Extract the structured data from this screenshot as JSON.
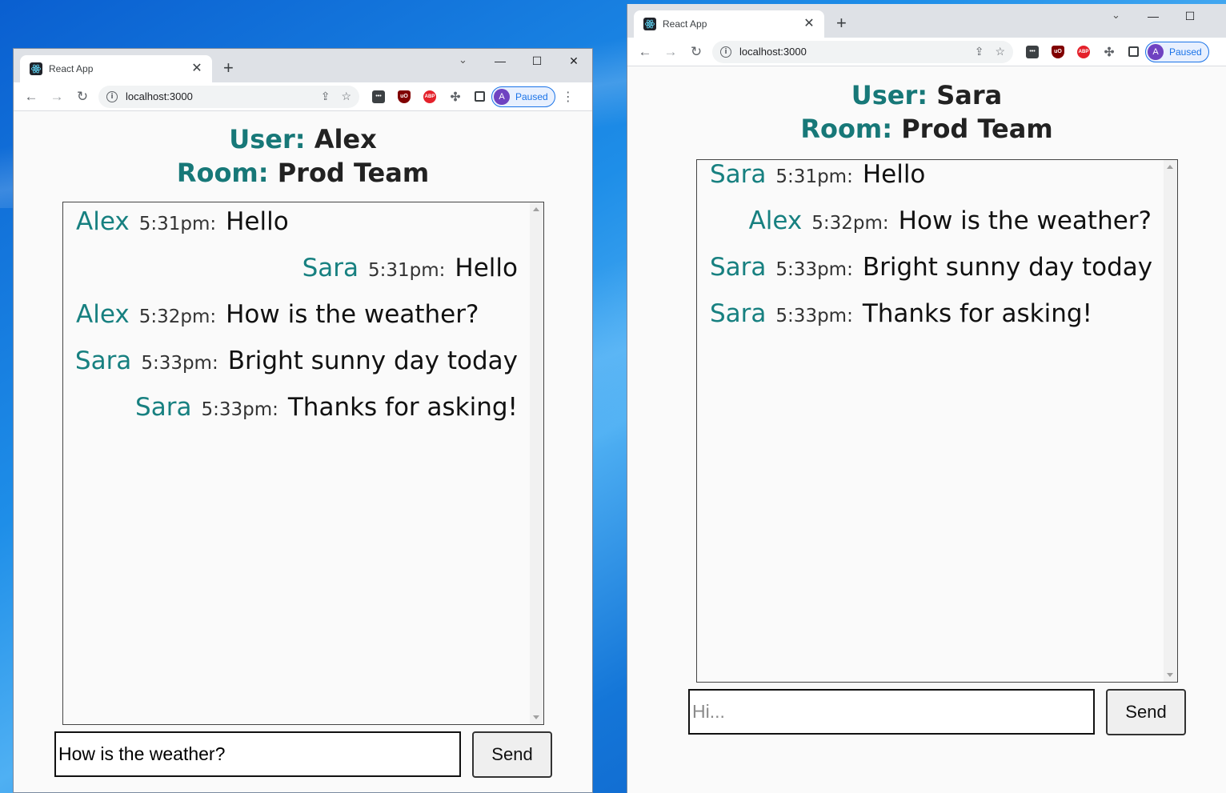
{
  "left_window": {
    "tab": {
      "favicon": "react-icon",
      "title": "React App",
      "close": "✕"
    },
    "new_tab": "+",
    "window_controls": {
      "tab_search": "⌄",
      "minimize": "—",
      "maximize": "☐",
      "close": "✕"
    },
    "toolbar": {
      "back": "←",
      "forward": "→",
      "reload": "↻",
      "url": "localhost:3000",
      "profile_initial": "A",
      "profile_status": "Paused",
      "menu": "⋮"
    },
    "header": {
      "user_label": "User:",
      "user_name": "Alex",
      "room_label": "Room:",
      "room_name": "Prod Team"
    },
    "messages": [
      {
        "user": "Alex",
        "time": "5:31pm:",
        "text": "Hello",
        "align": "left"
      },
      {
        "user": "Sara",
        "time": "5:31pm:",
        "text": "Hello",
        "align": "right"
      },
      {
        "user": "Alex",
        "time": "5:32pm:",
        "text": "How is the weather?",
        "align": "left"
      },
      {
        "user": "Sara",
        "time": "5:33pm:",
        "text": "Bright sunny day today",
        "align": "right"
      },
      {
        "user": "Sara",
        "time": "5:33pm:",
        "text": "Thanks for asking!",
        "align": "right"
      }
    ],
    "input_value": "How is the weather?",
    "send_label": "Send"
  },
  "right_window": {
    "tab": {
      "favicon": "react-icon",
      "title": "React App",
      "close": "✕"
    },
    "new_tab": "+",
    "window_controls": {
      "tab_search": "⌄",
      "minimize": "—",
      "maximize": "☐"
    },
    "toolbar": {
      "back": "←",
      "forward": "→",
      "reload": "↻",
      "url": "localhost:3000",
      "profile_initial": "A",
      "profile_status": "Paused"
    },
    "header": {
      "user_label": "User:",
      "user_name": "Sara",
      "room_label": "Room:",
      "room_name": "Prod Team"
    },
    "messages": [
      {
        "user": "Sara",
        "time": "5:31pm:",
        "text": "Hello",
        "align": "left"
      },
      {
        "user": "Alex",
        "time": "5:32pm:",
        "text": "How is the weather?",
        "align": "right"
      },
      {
        "user": "Sara",
        "time": "5:33pm:",
        "text": "Bright sunny day today",
        "align": "left"
      },
      {
        "user": "Sara",
        "time": "5:33pm:",
        "text": "Thanks for asking!",
        "align": "left"
      }
    ],
    "input_placeholder": "Hi...",
    "send_label": "Send"
  },
  "colors": {
    "accent": "#177878",
    "user_name_color": "#178080",
    "desktop": "#1e8ee8"
  }
}
